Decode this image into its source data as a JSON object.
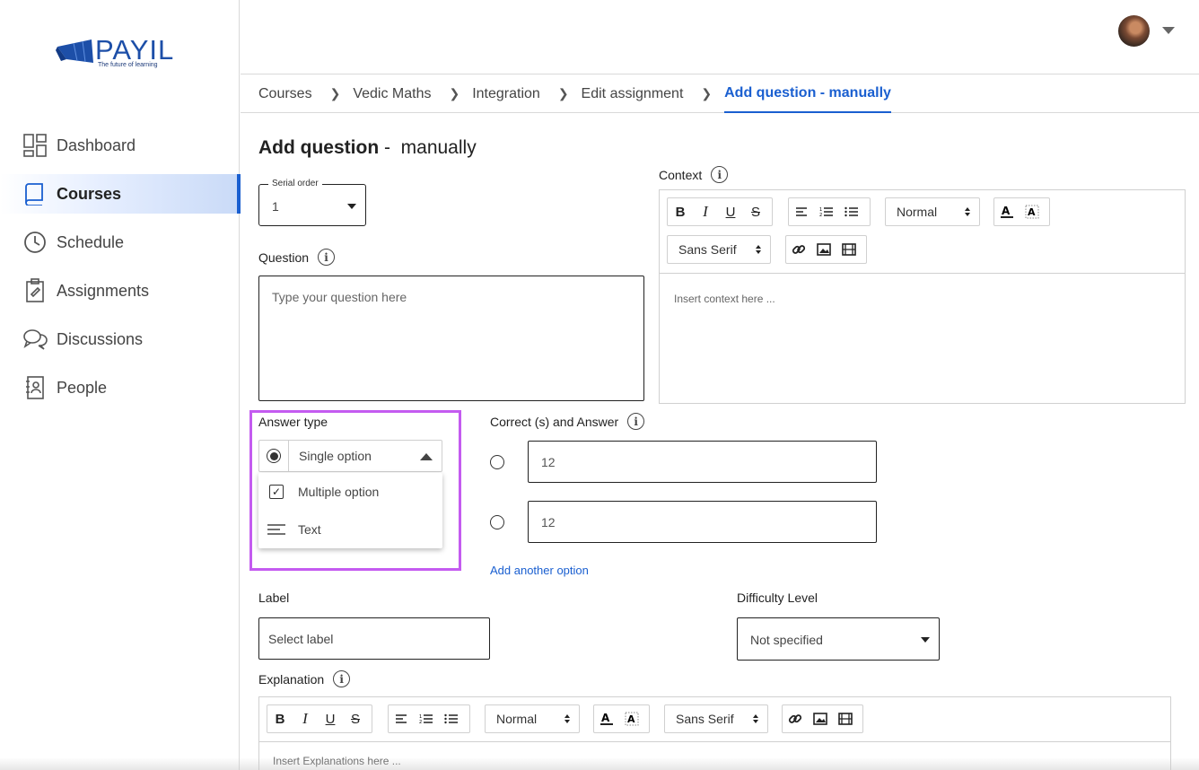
{
  "brand": {
    "name": "PAYIL",
    "tagline": "The future of learning",
    "color": "#1d4fa8"
  },
  "sidebar": {
    "items": [
      {
        "label": "Dashboard",
        "icon": "dashboard-icon",
        "active": false
      },
      {
        "label": "Courses",
        "icon": "book-icon",
        "active": true
      },
      {
        "label": "Schedule",
        "icon": "clock-icon",
        "active": false
      },
      {
        "label": "Assignments",
        "icon": "clipboard-icon",
        "active": false
      },
      {
        "label": "Discussions",
        "icon": "chat-icon",
        "active": false
      },
      {
        "label": "People",
        "icon": "contact-book-icon",
        "active": false
      }
    ]
  },
  "breadcrumb": [
    {
      "label": "Courses"
    },
    {
      "label": "Vedic Maths"
    },
    {
      "label": "Integration"
    },
    {
      "label": "Edit assignment"
    },
    {
      "label": "Add question - manually",
      "current": true
    }
  ],
  "page": {
    "title_strong": "Add question",
    "title_rest": " -  manually"
  },
  "serial_order": {
    "legend": "Serial order",
    "value": "1"
  },
  "question": {
    "label": "Question",
    "placeholder": "Type your question here"
  },
  "context": {
    "label": "Context",
    "heading_select": "Normal",
    "font_select": "Sans Serif",
    "placeholder": "Insert context here ..."
  },
  "answer_type": {
    "label": "Answer type",
    "selected": "Single option",
    "options": [
      {
        "label": "Multiple option",
        "icon": "checkbox-icon"
      },
      {
        "label": "Text",
        "icon": "text-lines-icon"
      }
    ]
  },
  "correct_answers": {
    "label": "Correct (s) and Answer",
    "options": [
      {
        "value": "12"
      },
      {
        "value": "12"
      }
    ],
    "add_link": "Add another option"
  },
  "label_field": {
    "label": "Label",
    "placeholder": "Select label"
  },
  "difficulty": {
    "label": "Difficulty Level",
    "value": "Not specified"
  },
  "explanation": {
    "label": "Explanation",
    "heading_select": "Normal",
    "font_select": "Sans Serif",
    "placeholder": "Insert Explanations here ..."
  },
  "colors": {
    "accent": "#1a5fd0",
    "highlight": "#c45bf0"
  }
}
